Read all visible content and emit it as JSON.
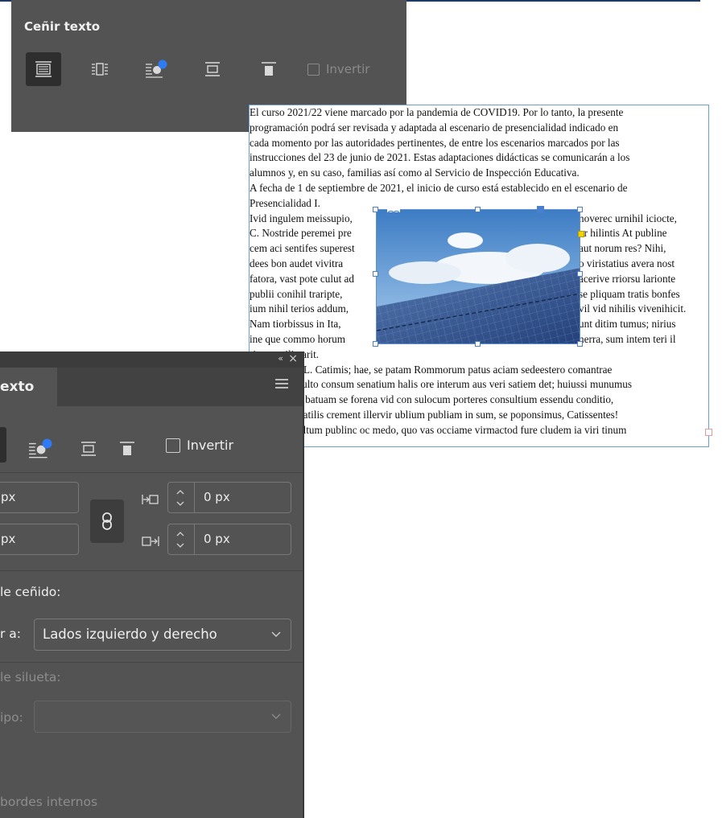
{
  "mini_panel": {
    "title": "Ceñir texto",
    "wrap_buttons": [
      {
        "icon": "wrap-none-icon",
        "active": true
      },
      {
        "icon": "wrap-bounding-box-icon",
        "active": false
      },
      {
        "icon": "wrap-object-shape-icon",
        "active": false
      },
      {
        "icon": "jump-object-icon",
        "active": false
      },
      {
        "icon": "jump-to-next-column-icon",
        "active": false
      }
    ],
    "invert_label": "Invertir"
  },
  "document": {
    "paragraph1": [
      "El curso 2021/22 viene marcado por la pandemia de COVID19. Por lo tanto, la presente",
      "programación podrá ser revisada y adaptada al escenario de presencialidad indicado en",
      "cada momento por las autoridades pertinentes, de entre los escenarios marcados por las",
      "instrucciones del 23 de junio de 2021. Estas adaptaciones didácticas se comunicarán a los",
      "alumnos y, en su caso, familias así como al Servicio de Inspección Educativa.",
      "A fecha de 1 de septiembre de 2021, el inicio de curso está establecido en el escenario de",
      "Presencialidad I."
    ],
    "left_column": [
      "Ivid ingulem meissupio,",
      "C. Nostride peremei pre",
      "cem aci sentifes superest",
      "dees bon audet vivitra",
      "fatora, vast pote culut ad",
      "publii conihil traripte,",
      "ium nihil terios addum,",
      "Nam tiorbissus in Ita,",
      "ine que commo horum",
      "rit restrailin arit."
    ],
    "right_column": [
      "noverec urnihil iciocte,",
      "ur hilintis At publine",
      "aut norum res? Nihi,",
      "o viristatius avera nost",
      "acerive rriorsu larionte",
      "se pliquam tratis bonfes",
      "vil vid nihilis vivenihicit.",
      "unt ditim tumus; nirius",
      "nerra, sum intem teri il"
    ],
    "paragraph2": [
      "t L. Catimis; hae, se patam Rommorum patus aciam sedeestero comantrae",
      "sulto consum senatium halis ore interum aus veri satiem det; huiussi munumus",
      "e batuam se forena vid con sulocum porteres consultium essendu conditio,",
      "natilis crement illervir ublium publiam in sum, se poponsimus, Catissentes!",
      "oltum publinc oc medo, quo vas occiame virmactod fure cludem ia viri tinum"
    ],
    "image_description_icon": "solar-panels-sky-image"
  },
  "panel": {
    "tab_label": "exto",
    "collapse_icon": "«",
    "close_icon": "×",
    "invert_label": "Invertir",
    "offsets": {
      "top_value": "px",
      "bottom_value": "px",
      "left_value": "0 px",
      "right_value": "0 px"
    },
    "wrap_options_label": "le ceñido:",
    "wrap_to_label": "r a:",
    "wrap_to_value": "Lados izquierdo y derecho",
    "contour_options_label": "le silueta:",
    "type_label": "ipo:",
    "type_value": "",
    "inner_edges_label": "bordes internos"
  },
  "colors": {
    "panel_bg": "#535353",
    "active_btn": "#2e2e2e",
    "selection": "#4a7fd0",
    "dot_blue": "#2f7bf5"
  }
}
